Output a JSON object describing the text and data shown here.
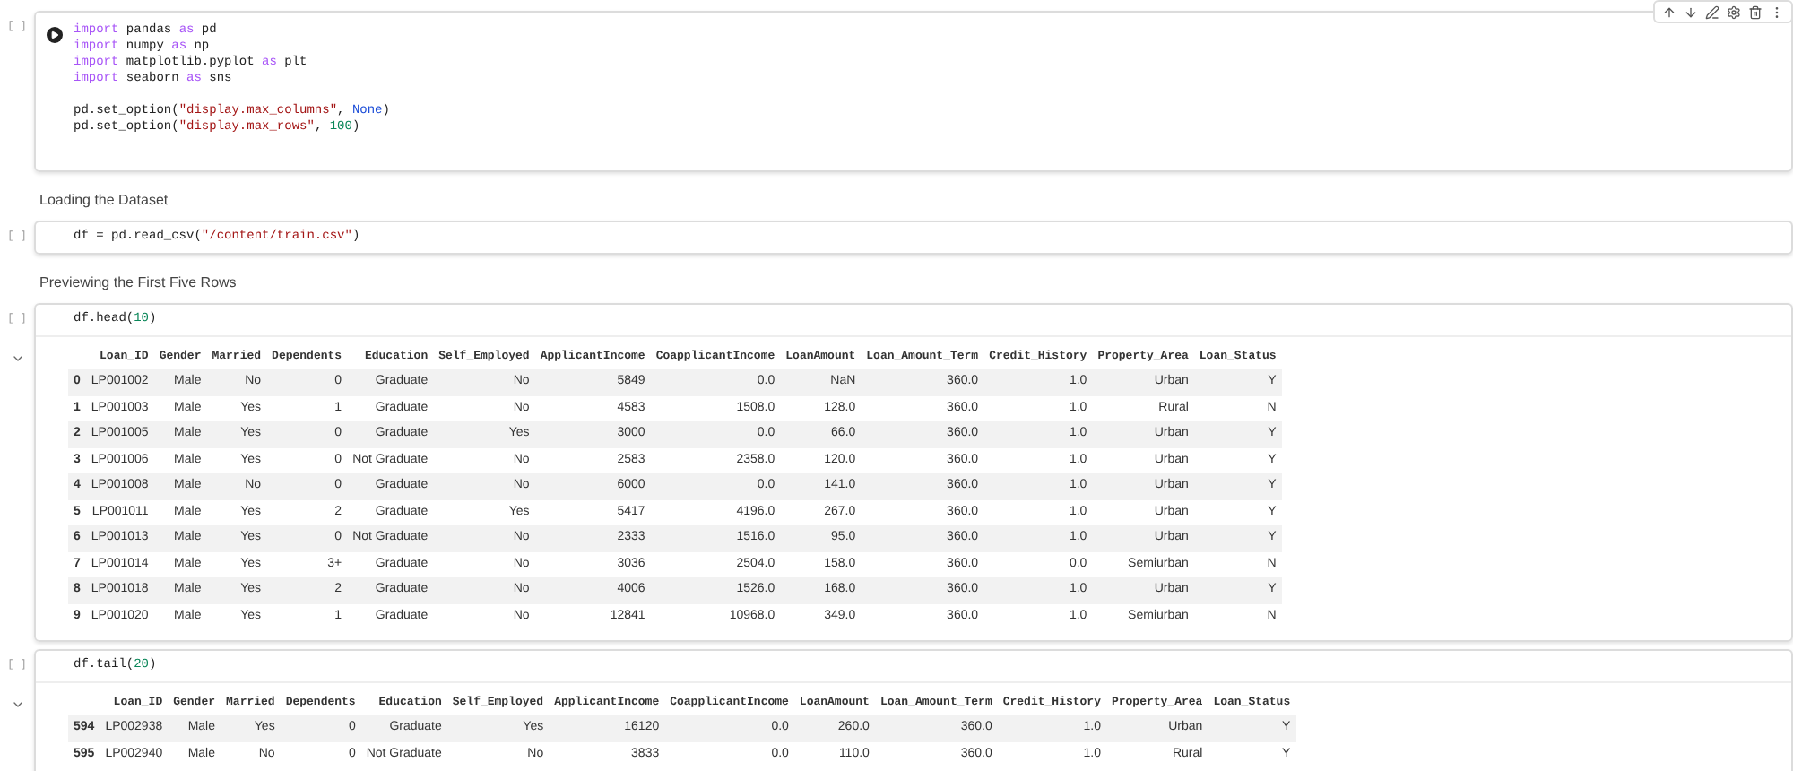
{
  "cell_toolbar": {
    "buttons": [
      {
        "kind": "up"
      },
      {
        "kind": "down"
      },
      {
        "kind": "edit"
      },
      {
        "kind": "settings"
      },
      {
        "kind": "delete"
      },
      {
        "kind": "more"
      }
    ]
  },
  "cells": [
    {
      "kind": "code",
      "bracket": "[ ]",
      "running_control": true,
      "blocks": [
        [
          [
            {
              "text": "import",
              "kind": "keyword"
            },
            {
              "text": " pandas ",
              "kind": "plain"
            },
            {
              "text": "as",
              "kind": "keyword"
            },
            {
              "text": " pd",
              "kind": "plain"
            }
          ],
          [
            {
              "text": "import",
              "kind": "keyword"
            },
            {
              "text": " numpy ",
              "kind": "plain"
            },
            {
              "text": "as",
              "kind": "keyword"
            },
            {
              "text": " np",
              "kind": "plain"
            }
          ],
          [
            {
              "text": "import",
              "kind": "keyword"
            },
            {
              "text": " matplotlib.pyplot ",
              "kind": "plain"
            },
            {
              "text": "as",
              "kind": "keyword"
            },
            {
              "text": " plt",
              "kind": "plain"
            }
          ],
          [
            {
              "text": "import",
              "kind": "keyword"
            },
            {
              "text": " seaborn ",
              "kind": "plain"
            },
            {
              "text": "as",
              "kind": "keyword"
            },
            {
              "text": " sns",
              "kind": "plain"
            }
          ]
        ],
        [
          [
            {
              "text": "pd.set_option(",
              "kind": "plain"
            },
            {
              "text": "\"display.max_columns\"",
              "kind": "string"
            },
            {
              "text": ", ",
              "kind": "plain"
            },
            {
              "text": "None",
              "kind": "constant"
            },
            {
              "text": ")",
              "kind": "plain"
            }
          ],
          [
            {
              "text": "pd.set_option(",
              "kind": "plain"
            },
            {
              "text": "\"display.max_rows\"",
              "kind": "string"
            },
            {
              "text": ", ",
              "kind": "plain"
            },
            {
              "text": "100",
              "kind": "number"
            },
            {
              "text": ")",
              "kind": "plain"
            }
          ]
        ]
      ]
    },
    {
      "kind": "text",
      "text": "Loading the Dataset"
    },
    {
      "kind": "code",
      "bracket": "[ ]",
      "running_control": false,
      "blocks": [
        [
          [
            {
              "text": "df = pd.read_csv(",
              "kind": "plain"
            },
            {
              "text": "\"/content/train.csv\"",
              "kind": "string"
            },
            {
              "text": ")",
              "kind": "plain"
            }
          ]
        ]
      ]
    },
    {
      "kind": "text",
      "text": "Previewing the First Five Rows"
    },
    {
      "kind": "code",
      "bracket": "[ ]",
      "running_control": false,
      "blocks": [
        [
          [
            {
              "text": "df.head(",
              "kind": "plain"
            },
            {
              "text": "10",
              "kind": "number"
            },
            {
              "text": ")",
              "kind": "plain"
            }
          ]
        ]
      ],
      "output": {
        "columns": [
          "Loan_ID",
          "Gender",
          "Married",
          "Dependents",
          "Education",
          "Self_Employed",
          "ApplicantIncome",
          "CoapplicantIncome",
          "LoanAmount",
          "Loan_Amount_Term",
          "Credit_History",
          "Property_Area",
          "Loan_Status"
        ],
        "rows": [
          {
            "index": "0",
            "cells": [
              "LP001002",
              "Male",
              "No",
              "0",
              "Graduate",
              "No",
              "5849",
              "0.0",
              "NaN",
              "360.0",
              "1.0",
              "Urban",
              "Y"
            ]
          },
          {
            "index": "1",
            "cells": [
              "LP001003",
              "Male",
              "Yes",
              "1",
              "Graduate",
              "No",
              "4583",
              "1508.0",
              "128.0",
              "360.0",
              "1.0",
              "Rural",
              "N"
            ]
          },
          {
            "index": "2",
            "cells": [
              "LP001005",
              "Male",
              "Yes",
              "0",
              "Graduate",
              "Yes",
              "3000",
              "0.0",
              "66.0",
              "360.0",
              "1.0",
              "Urban",
              "Y"
            ]
          },
          {
            "index": "3",
            "cells": [
              "LP001006",
              "Male",
              "Yes",
              "0",
              "Not Graduate",
              "No",
              "2583",
              "2358.0",
              "120.0",
              "360.0",
              "1.0",
              "Urban",
              "Y"
            ]
          },
          {
            "index": "4",
            "cells": [
              "LP001008",
              "Male",
              "No",
              "0",
              "Graduate",
              "No",
              "6000",
              "0.0",
              "141.0",
              "360.0",
              "1.0",
              "Urban",
              "Y"
            ]
          },
          {
            "index": "5",
            "cells": [
              "LP001011",
              "Male",
              "Yes",
              "2",
              "Graduate",
              "Yes",
              "5417",
              "4196.0",
              "267.0",
              "360.0",
              "1.0",
              "Urban",
              "Y"
            ]
          },
          {
            "index": "6",
            "cells": [
              "LP001013",
              "Male",
              "Yes",
              "0",
              "Not Graduate",
              "No",
              "2333",
              "1516.0",
              "95.0",
              "360.0",
              "1.0",
              "Urban",
              "Y"
            ]
          },
          {
            "index": "7",
            "cells": [
              "LP001014",
              "Male",
              "Yes",
              "3+",
              "Graduate",
              "No",
              "3036",
              "2504.0",
              "158.0",
              "360.0",
              "0.0",
              "Semiurban",
              "N"
            ]
          },
          {
            "index": "8",
            "cells": [
              "LP001018",
              "Male",
              "Yes",
              "2",
              "Graduate",
              "No",
              "4006",
              "1526.0",
              "168.0",
              "360.0",
              "1.0",
              "Urban",
              "Y"
            ]
          },
          {
            "index": "9",
            "cells": [
              "LP001020",
              "Male",
              "Yes",
              "1",
              "Graduate",
              "No",
              "12841",
              "10968.0",
              "349.0",
              "360.0",
              "1.0",
              "Semiurban",
              "N"
            ]
          }
        ]
      }
    },
    {
      "kind": "code",
      "bracket": "[ ]",
      "running_control": false,
      "blocks": [
        [
          [
            {
              "text": "df.tail(",
              "kind": "plain"
            },
            {
              "text": "20",
              "kind": "number"
            },
            {
              "text": ")",
              "kind": "plain"
            }
          ]
        ]
      ],
      "output": {
        "columns": [
          "Loan_ID",
          "Gender",
          "Married",
          "Dependents",
          "Education",
          "Self_Employed",
          "ApplicantIncome",
          "CoapplicantIncome",
          "LoanAmount",
          "Loan_Amount_Term",
          "Credit_History",
          "Property_Area",
          "Loan_Status"
        ],
        "rows": [
          {
            "index": "594",
            "cells": [
              "LP002938",
              "Male",
              "Yes",
              "0",
              "Graduate",
              "Yes",
              "16120",
              "0.0",
              "260.0",
              "360.0",
              "1.0",
              "Urban",
              "Y"
            ]
          },
          {
            "index": "595",
            "cells": [
              "LP002940",
              "Male",
              "No",
              "0",
              "Not Graduate",
              "No",
              "3833",
              "0.0",
              "110.0",
              "360.0",
              "1.0",
              "Rural",
              "Y"
            ]
          }
        ]
      }
    }
  ]
}
